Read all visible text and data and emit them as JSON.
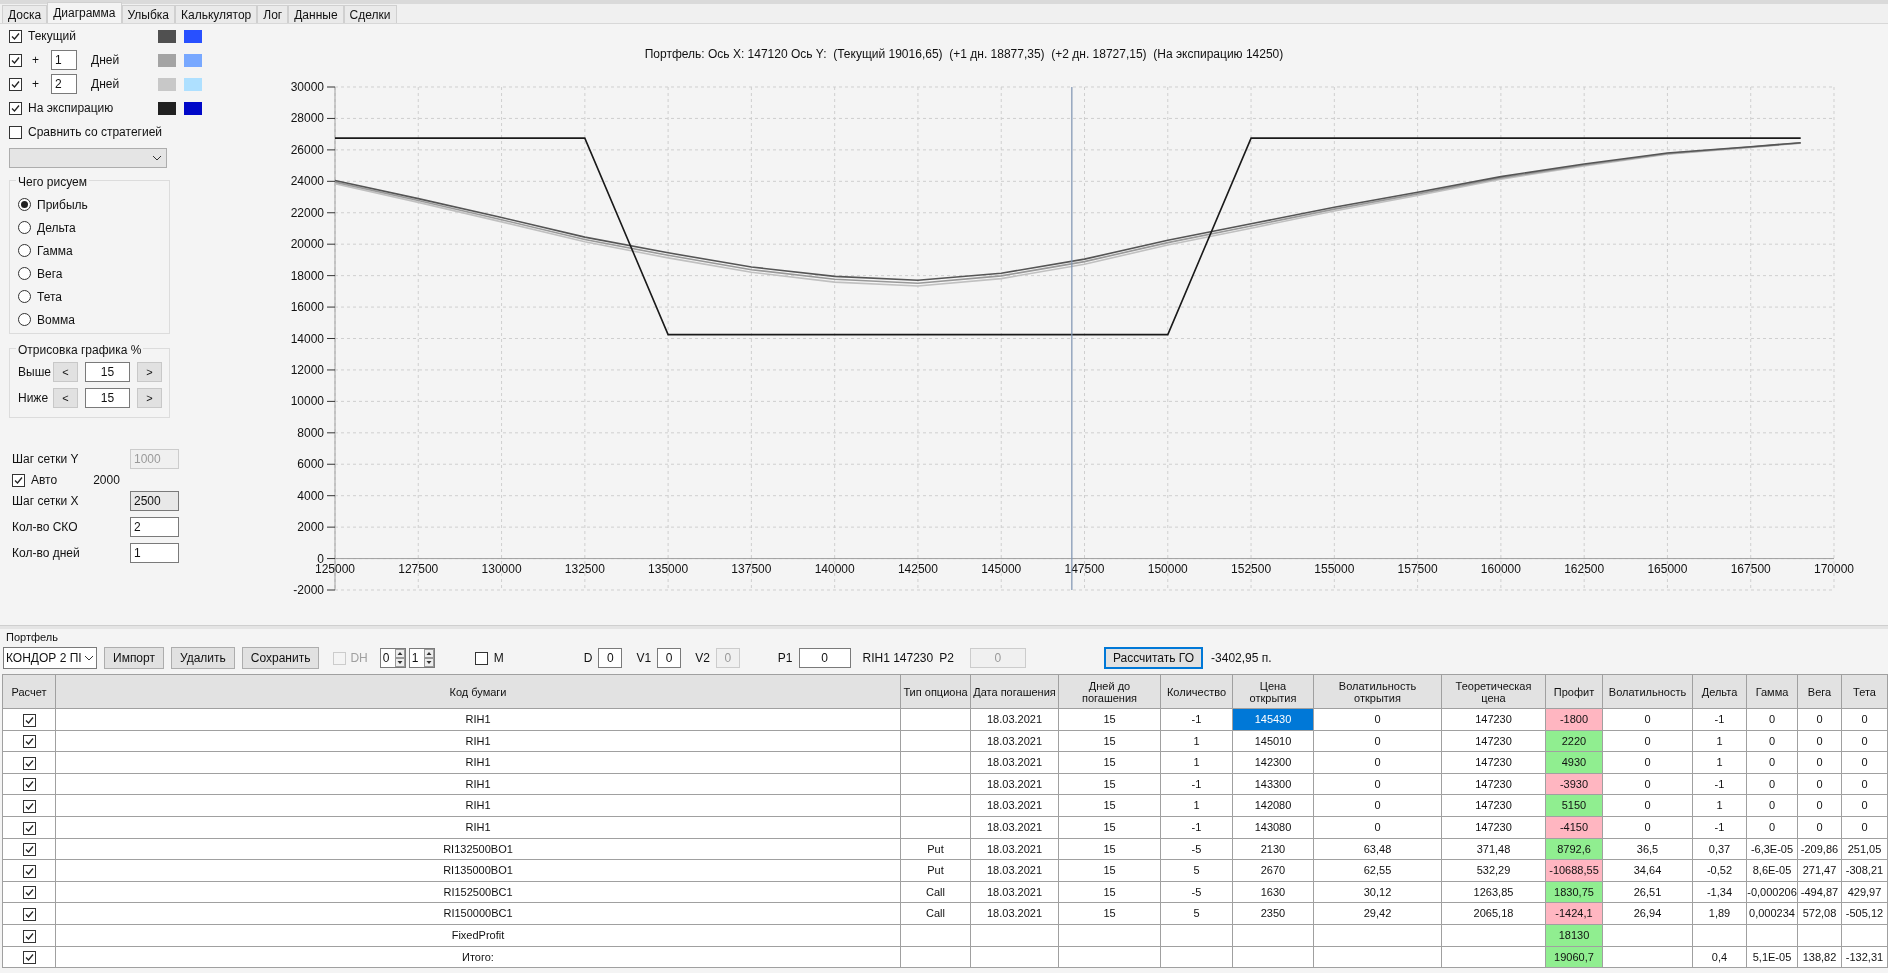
{
  "tabs": [
    {
      "label": "Доска",
      "selected": false
    },
    {
      "label": "Диаграмма",
      "selected": true
    },
    {
      "label": "Улыбка",
      "selected": false
    },
    {
      "label": "Калькулятор",
      "selected": false
    },
    {
      "label": "Лог",
      "selected": false
    },
    {
      "label": "Данные",
      "selected": false
    },
    {
      "label": "Сделки",
      "selected": false
    }
  ],
  "curves": [
    {
      "kind": "plain",
      "label": "Текущий",
      "checked": true,
      "swatches": [
        {
          "color": "#505050"
        },
        {
          "color": "#2850ff"
        }
      ]
    },
    {
      "kind": "days",
      "prefix": "+",
      "value": "1",
      "unit": "Дней",
      "checked": true,
      "swatches": [
        {
          "color": "#a4a4a4"
        },
        {
          "color": "#78a8ff"
        }
      ]
    },
    {
      "kind": "days",
      "prefix": "+",
      "value": "2",
      "unit": "Дней",
      "checked": true,
      "swatches": [
        {
          "color": "#c8c8c8"
        },
        {
          "color": "#aee0ff"
        }
      ]
    },
    {
      "kind": "plain",
      "label": "На экспирацию",
      "checked": true,
      "swatches": [
        {
          "color": "#202020"
        },
        {
          "color": "#0008c8"
        }
      ]
    },
    {
      "kind": "plain",
      "label": "Сравнить со стратегией",
      "checked": false
    }
  ],
  "draw_group": {
    "title": "Чего рисуем",
    "options": [
      {
        "label": "Прибыль",
        "selected": true
      },
      {
        "label": "Дельта",
        "selected": false
      },
      {
        "label": "Гамма",
        "selected": false
      },
      {
        "label": "Вега",
        "selected": false
      },
      {
        "label": "Тета",
        "selected": false
      },
      {
        "label": "Вомма",
        "selected": false
      }
    ]
  },
  "render_group": {
    "title": "Отрисовка графика %",
    "rows": [
      {
        "label": "Выше",
        "dec": "<",
        "value": "15",
        "inc": ">"
      },
      {
        "label": "Ниже",
        "dec": "<",
        "value": "15",
        "inc": ">"
      }
    ]
  },
  "grid_settings": [
    {
      "kind": "field",
      "label": "Шаг сетки Y",
      "value": "1000",
      "disabled": true,
      "readonly": false
    },
    {
      "kind": "checkbox",
      "label": "Авто",
      "checked": true,
      "note": "2000"
    },
    {
      "kind": "field",
      "label": "Шаг сетки X",
      "value": "2500",
      "disabled": false,
      "readonly": true
    },
    {
      "kind": "field",
      "label": "Кол-во СКО",
      "value": "2",
      "disabled": false,
      "readonly": false
    },
    {
      "kind": "field",
      "label": "Кол-во дней",
      "value": "1",
      "disabled": false,
      "readonly": false
    }
  ],
  "chart": {
    "title": "Портфель: Ось X: 147120 Ось Y:  (Текущий 19016,65)  (+1 дн. 18877,35)  (+2 дн. 18727,15)  (На экспирацию 14250)",
    "chart_data": {
      "type": "line",
      "x": [
        125000,
        127500,
        130000,
        132500,
        135000,
        137500,
        140000,
        142500,
        145000,
        147500,
        150000,
        152500,
        155000,
        157500,
        160000,
        162500,
        165000,
        167500,
        169000
      ],
      "series": [
        {
          "color": "#1a1a1a",
          "values": [
            26750,
            26750,
            26750,
            26750,
            14250,
            14250,
            14250,
            14250,
            14250,
            14250,
            14250,
            26750,
            26750,
            26750,
            26750,
            26750,
            26750,
            26750,
            26750
          ]
        },
        {
          "color": "#555555",
          "values": [
            24050,
            22900,
            21700,
            20450,
            19450,
            18550,
            17950,
            17700,
            18150,
            19050,
            20250,
            21300,
            22350,
            23300,
            24300,
            25100,
            25800,
            26200,
            26450
          ]
        },
        {
          "color": "#999999",
          "values": [
            23950,
            22780,
            21560,
            20300,
            19290,
            18380,
            17770,
            17520,
            17980,
            18890,
            20100,
            21160,
            22230,
            23200,
            24220,
            25040,
            25760,
            26180,
            26440
          ]
        },
        {
          "color": "#c0c0c0",
          "values": [
            23850,
            22660,
            21420,
            20150,
            19130,
            18210,
            17590,
            17340,
            17810,
            18730,
            19950,
            21020,
            22110,
            23100,
            24140,
            24980,
            25720,
            26160,
            26430
          ]
        }
      ],
      "xlim": [
        125000,
        170000
      ],
      "ylim": [
        -2000,
        30000
      ],
      "xticks": [
        125000,
        127500,
        130000,
        132500,
        135000,
        137500,
        140000,
        142500,
        145000,
        147500,
        150000,
        152500,
        155000,
        157500,
        160000,
        162500,
        165000,
        167500,
        170000
      ],
      "yticks": [
        -2000,
        0,
        2000,
        4000,
        6000,
        8000,
        10000,
        12000,
        14000,
        16000,
        18000,
        20000,
        22000,
        24000,
        26000,
        28000,
        30000
      ],
      "grid": true,
      "ref_lines": [
        {
          "axis": "x",
          "value": 147120
        }
      ]
    }
  },
  "portfolio": {
    "title": "Портфель",
    "strategy": "КОНДОР 2 ПI",
    "buttons": [
      "Импорт",
      "Удалить",
      "Сохранить"
    ],
    "dh": {
      "label": "DH",
      "checked": false,
      "disabled": true
    },
    "spinners": [
      "0",
      "1"
    ],
    "m": {
      "label": "M",
      "checked": false
    },
    "params": [
      {
        "label": "D",
        "value": "0",
        "disabled": false
      },
      {
        "label": "V1",
        "value": "0",
        "disabled": false
      },
      {
        "label": "V2",
        "value": "0",
        "disabled": true
      },
      {
        "label": "P1",
        "value": "0",
        "disabled": false
      }
    ],
    "instrument": "RIH1 147230",
    "p2": {
      "label": "P2",
      "value": "0",
      "disabled": true
    },
    "calc_button": "Рассчитать ГО",
    "margin": "-3402,95 п."
  },
  "table": {
    "columns": [
      "Расчет",
      "Код бумаги",
      "Тип опциона",
      "Дата погашения",
      "Дней до погашения",
      "Количество",
      "Цена открытия",
      "Волатильность открытия",
      "Теоретическая цена",
      "Профит",
      "Волатильность",
      "Дельта",
      "Гамма",
      "Вега",
      "Тета"
    ],
    "rows": [
      {
        "checked": true,
        "selected": true,
        "color": "#ffb6c1",
        "cells": [
          "",
          "RIH1",
          "",
          "18.03.2021",
          "15",
          "-1",
          "145430",
          "0",
          "147230",
          "-1800",
          "0",
          "-1",
          "0",
          "0",
          "0"
        ]
      },
      {
        "checked": true,
        "selected": false,
        "color": "#90ee90",
        "cells": [
          "",
          "RIH1",
          "",
          "18.03.2021",
          "15",
          "1",
          "145010",
          "0",
          "147230",
          "2220",
          "0",
          "1",
          "0",
          "0",
          "0"
        ]
      },
      {
        "checked": true,
        "selected": false,
        "color": "#90ee90",
        "cells": [
          "",
          "RIH1",
          "",
          "18.03.2021",
          "15",
          "1",
          "142300",
          "0",
          "147230",
          "4930",
          "0",
          "1",
          "0",
          "0",
          "0"
        ]
      },
      {
        "checked": true,
        "selected": false,
        "color": "#ffb6c1",
        "cells": [
          "",
          "RIH1",
          "",
          "18.03.2021",
          "15",
          "-1",
          "143300",
          "0",
          "147230",
          "-3930",
          "0",
          "-1",
          "0",
          "0",
          "0"
        ]
      },
      {
        "checked": true,
        "selected": false,
        "color": "#90ee90",
        "cells": [
          "",
          "RIH1",
          "",
          "18.03.2021",
          "15",
          "1",
          "142080",
          "0",
          "147230",
          "5150",
          "0",
          "1",
          "0",
          "0",
          "0"
        ]
      },
      {
        "checked": true,
        "selected": false,
        "color": "#ffb6c1",
        "cells": [
          "",
          "RIH1",
          "",
          "18.03.2021",
          "15",
          "-1",
          "143080",
          "0",
          "147230",
          "-4150",
          "0",
          "-1",
          "0",
          "0",
          "0"
        ]
      },
      {
        "checked": true,
        "selected": false,
        "color": "#90ee90",
        "cells": [
          "",
          "RI132500BO1",
          "Put",
          "18.03.2021",
          "15",
          "-5",
          "2130",
          "63,48",
          "371,48",
          "8792,6",
          "36,5",
          "0,37",
          "-6,3E-05",
          "-209,86",
          "251,05"
        ]
      },
      {
        "checked": true,
        "selected": false,
        "color": "#ffb6c1",
        "cells": [
          "",
          "RI135000BO1",
          "Put",
          "18.03.2021",
          "15",
          "5",
          "2670",
          "62,55",
          "532,29",
          "-10688,55",
          "34,64",
          "-0,52",
          "8,6E-05",
          "271,47",
          "-308,21"
        ]
      },
      {
        "checked": true,
        "selected": false,
        "color": "#90ee90",
        "cells": [
          "",
          "RI152500BC1",
          "Call",
          "18.03.2021",
          "15",
          "-5",
          "1630",
          "30,12",
          "1263,85",
          "1830,75",
          "26,51",
          "-1,34",
          "-0,000206",
          "-494,87",
          "429,97"
        ]
      },
      {
        "checked": true,
        "selected": false,
        "color": "#ffb6c1",
        "cells": [
          "",
          "RI150000BC1",
          "Call",
          "18.03.2021",
          "15",
          "5",
          "2350",
          "29,42",
          "2065,18",
          "-1424,1",
          "26,94",
          "1,89",
          "0,000234",
          "572,08",
          "-505,12"
        ]
      },
      {
        "checked": true,
        "selected": false,
        "color": "#90ee90",
        "cells": [
          "",
          "FixedProfit",
          "",
          "",
          "",
          "",
          "",
          "",
          "",
          "18130",
          "",
          "",
          "",
          "",
          ""
        ]
      },
      {
        "checked": true,
        "selected": false,
        "color": "#90ee90",
        "cells": [
          "",
          "Итого:",
          "",
          "",
          "",
          "",
          "",
          "",
          "",
          "19060,7",
          "",
          "0,4",
          "5,1E-05",
          "138,82",
          "-132,31"
        ]
      }
    ]
  }
}
